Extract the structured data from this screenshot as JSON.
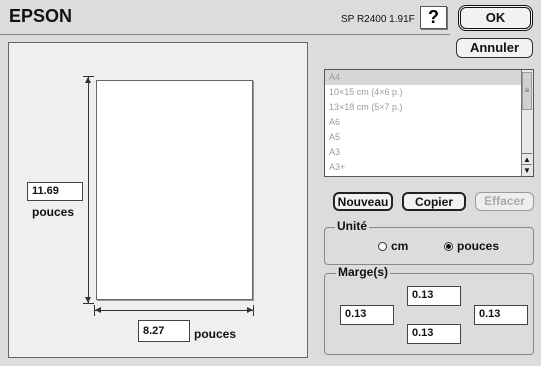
{
  "header": {
    "brand": "EPSON",
    "model": "SP R2400 1.91F",
    "help_label": "?",
    "ok_label": "OK",
    "cancel_label": "Annuler"
  },
  "preview": {
    "height_value": "11.69",
    "height_unit": "pouces",
    "width_value": "8.27",
    "width_unit": "pouces"
  },
  "paper_list": {
    "items": [
      "A4",
      "10×15 cm (4×6 p.)",
      "13×18 cm (5×7 p.)",
      "A6",
      "A5",
      "A3",
      "A3+"
    ],
    "selected": "A4"
  },
  "list_buttons": {
    "new_label": "Nouveau",
    "copy_label": "Copier",
    "delete_label": "Effacer"
  },
  "units": {
    "title": "Unité",
    "cm_label": "cm",
    "inch_label": "pouces",
    "selected": "pouces"
  },
  "margins": {
    "title": "Marge(s)",
    "top": "0.13",
    "left": "0.13",
    "right": "0.13",
    "bottom": "0.13"
  },
  "icons": {
    "radio_on": "radio-selected-icon",
    "radio_off": "radio-unselected-icon",
    "scroll_up": "scroll-up-icon",
    "scroll_down": "scroll-down-icon"
  }
}
